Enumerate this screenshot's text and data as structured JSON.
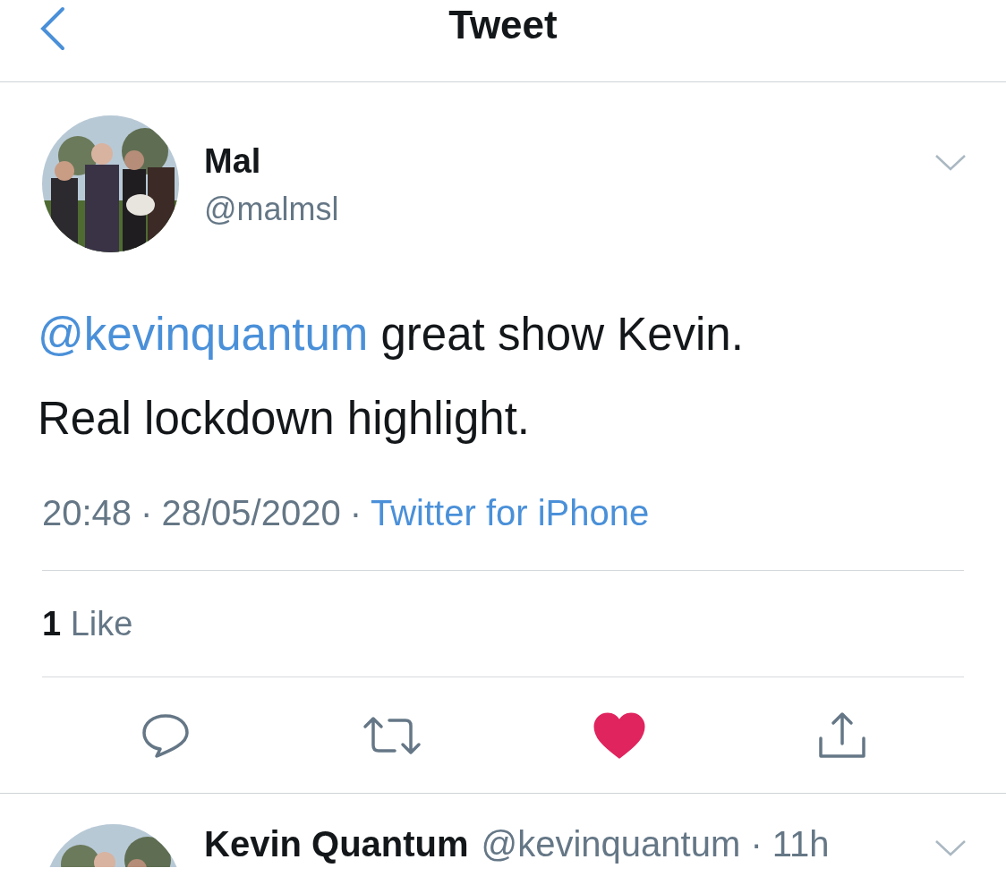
{
  "header": {
    "title": "Tweet"
  },
  "tweet": {
    "name": "Mal",
    "handle": "@malmsl",
    "mention": "@kevinquantum",
    "text": "great show Kevin. Real lockdown highlight.",
    "time": "20:48",
    "separator": "·",
    "date": "28/05/2020",
    "source": "Twitter for iPhone",
    "likes": "**1** Like",
    "liked": true
  },
  "reply": {
    "name": "Kevin Quantum",
    "handle": "@kevinquantum",
    "separator": "·",
    "time": "11h"
  }
}
